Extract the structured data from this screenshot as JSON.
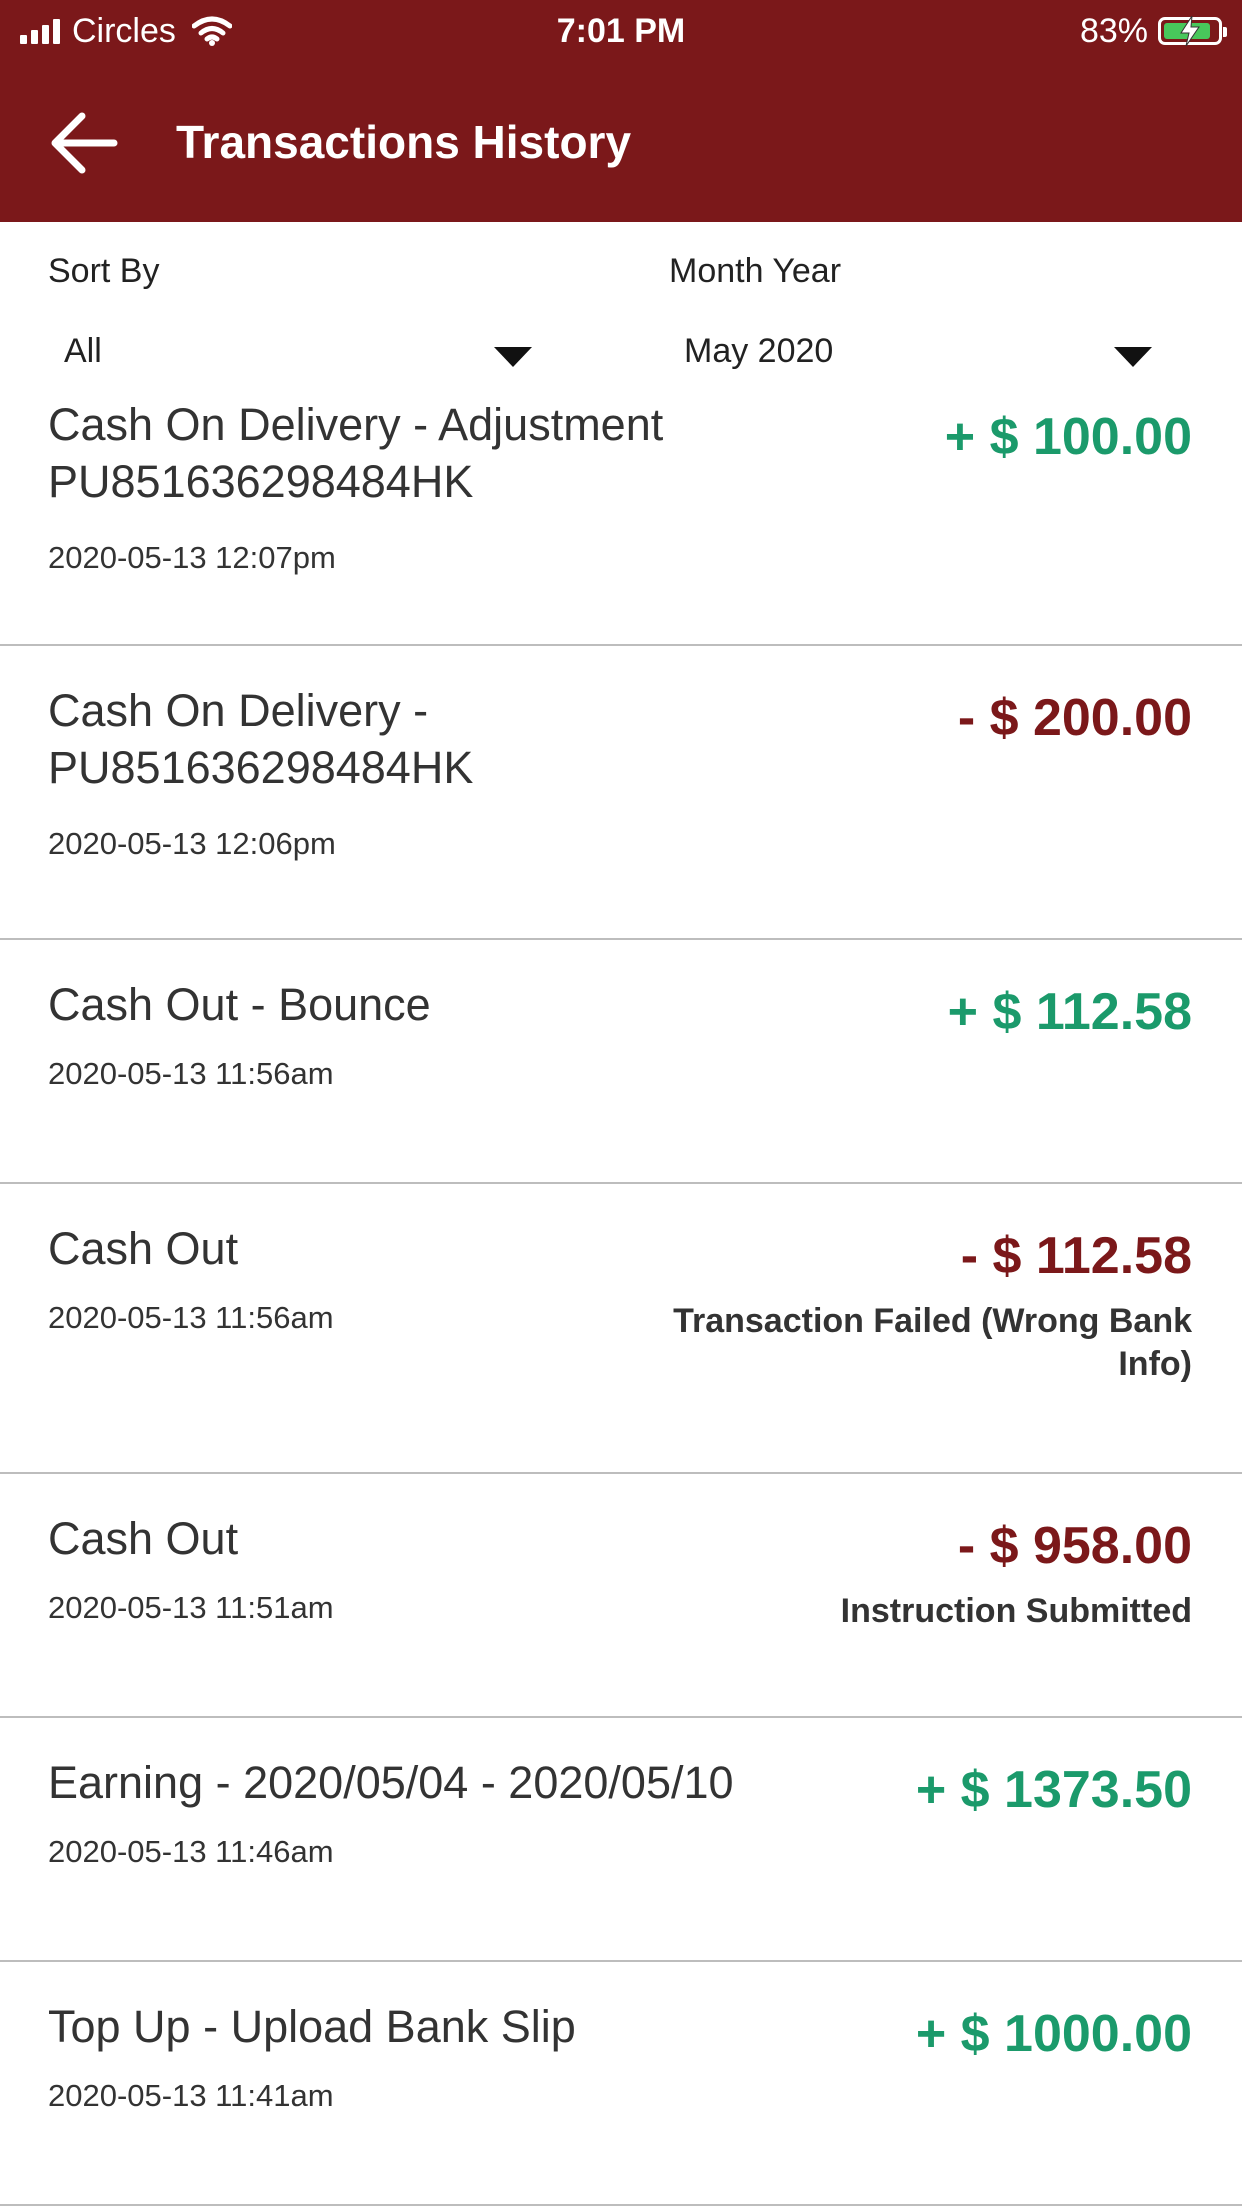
{
  "status_bar": {
    "carrier": "Circles",
    "time": "7:01 PM",
    "battery": "83%"
  },
  "header": {
    "title": "Transactions History"
  },
  "filters": {
    "sort_label": "Sort By",
    "sort_value": "All",
    "month_label": "Month Year",
    "month_value": "May 2020"
  },
  "colors": {
    "brand": "#7b181a",
    "positive": "#1b9a6b",
    "negative": "#7b181a"
  },
  "transactions": [
    {
      "line1": "Cash On Delivery - Adjustment",
      "line2": "PU851636298484HK",
      "date": "2020-05-13 12:07pm",
      "amount": "+ $ 100.00",
      "note": ""
    },
    {
      "line1": "Cash On Delivery -",
      "line2": "PU851636298484HK",
      "date": "2020-05-13 12:06pm",
      "amount": "- $ 200.00",
      "note": ""
    },
    {
      "line1": "Cash Out - Bounce",
      "line2": "",
      "date": "2020-05-13 11:56am",
      "amount": "+ $ 112.58",
      "note": ""
    },
    {
      "line1": "Cash Out",
      "line2": "",
      "date": "2020-05-13 11:56am",
      "amount": "- $ 112.58",
      "note": "Transaction Failed (Wrong Bank Info)"
    },
    {
      "line1": "Cash Out",
      "line2": "",
      "date": "2020-05-13 11:51am",
      "amount": "- $ 958.00",
      "note": "Instruction Submitted"
    },
    {
      "line1": "Earning - 2020/05/04 - 2020/05/10",
      "line2": "",
      "date": "2020-05-13 11:46am",
      "amount": "+ $ 1373.50",
      "note": ""
    },
    {
      "line1": "Top Up - Upload Bank Slip",
      "line2": "",
      "date": "2020-05-13 11:41am",
      "amount": "+ $ 1000.00",
      "note": ""
    }
  ]
}
